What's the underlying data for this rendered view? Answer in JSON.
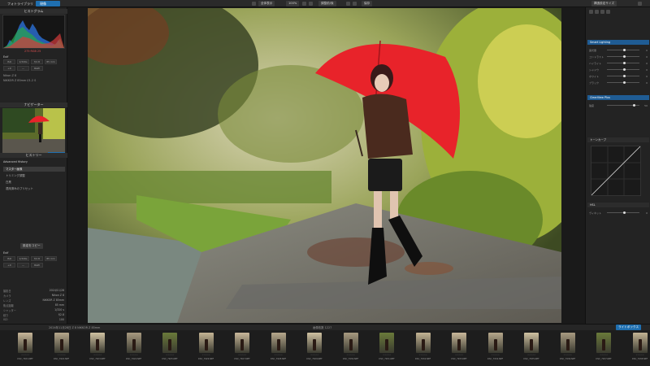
{
  "topbar": {
    "tab_library": "フォトライブラリ",
    "tab_develop": "現像",
    "left_panel_title": "ヒストグラム",
    "zoom_label": "100%",
    "fit_label": "全体表示",
    "compare_label": "調整前/後",
    "export_label": "保存",
    "right_label": "構造設定サイズ"
  },
  "left": {
    "histogram_title": "ヒストグラム",
    "hist_values": "275 RGB 25",
    "exif_title": "Exif",
    "exif_cells_row1": [
      "ISO",
      "1/320s",
      "f/2.8",
      "85 mm"
    ],
    "exif_cells_row2": [
      "+0",
      "—",
      "RAW"
    ],
    "camera": "Nikon Z 8",
    "lens": "NIKKOR Z 85mm f/1.2 S",
    "navigator_title": "ナビゲーター",
    "history_title": "ヒストリー",
    "history_head": "Advanced History",
    "history_items": [
      "マスター画像",
      "トリミング調整",
      "白黒",
      "適用済みのプリセット"
    ],
    "copy_settings": "設定をコピー",
    "exif2_title": "Exif",
    "meta_rows": [
      {
        "k": "撮影日",
        "v": "2024/11/28"
      },
      {
        "k": "カメラ",
        "v": "Nikon Z 8"
      },
      {
        "k": "レンズ",
        "v": "NIKKOR Z 85mm"
      },
      {
        "k": "焦点距離",
        "v": "85 mm"
      },
      {
        "k": "シャッター",
        "v": "1/320 s"
      },
      {
        "k": "絞り",
        "v": "f/2.8"
      },
      {
        "k": "ISO",
        "v": "100"
      },
      {
        "k": "評価",
        "v": "☆☆☆☆☆"
      }
    ]
  },
  "right": {
    "section1": "Smart Lighting",
    "section2": "ClearView Plus",
    "section3": "トーンカーブ",
    "section4": "HSL",
    "sliders": [
      {
        "label": "露光量",
        "value": "0"
      },
      {
        "label": "コントラスト",
        "value": "0"
      },
      {
        "label": "ハイライト",
        "value": "0"
      },
      {
        "label": "シャドウ",
        "value": "0"
      },
      {
        "label": "ホワイト",
        "value": "0"
      },
      {
        "label": "ブラック",
        "value": "0"
      },
      {
        "label": "強度",
        "value": "50"
      },
      {
        "label": "ヴィネット",
        "value": "0"
      }
    ]
  },
  "filmstrip": {
    "bar_left": "2024年11月28日 Z 8 NIKKOR Z 85mm",
    "bar_center": "画像枚数 1227",
    "bar_right": "ライトボックス",
    "files": [
      "DSC_7921.NEF",
      "DSC_7922.NEF",
      "DSC_7923.NEF",
      "DSC_7924.NEF",
      "DSC_7925.NEF",
      "DSC_7926.NEF",
      "DSC_7927.NEF",
      "DSC_7928.NEF",
      "DSC_7929.NEF",
      "DSC_7930.NEF",
      "DSC_7931.NEF",
      "DSC_7932.NEF",
      "DSC_7933.NEF",
      "DSC_7934.NEF",
      "DSC_7935.NEF",
      "DSC_7936.NEF",
      "DSC_7937.NEF",
      "DSC_7938.NEF"
    ],
    "stars": "☆☆☆☆☆"
  },
  "colors": {
    "accent": "#1f6fb0",
    "umbrella": "#e8232a"
  }
}
